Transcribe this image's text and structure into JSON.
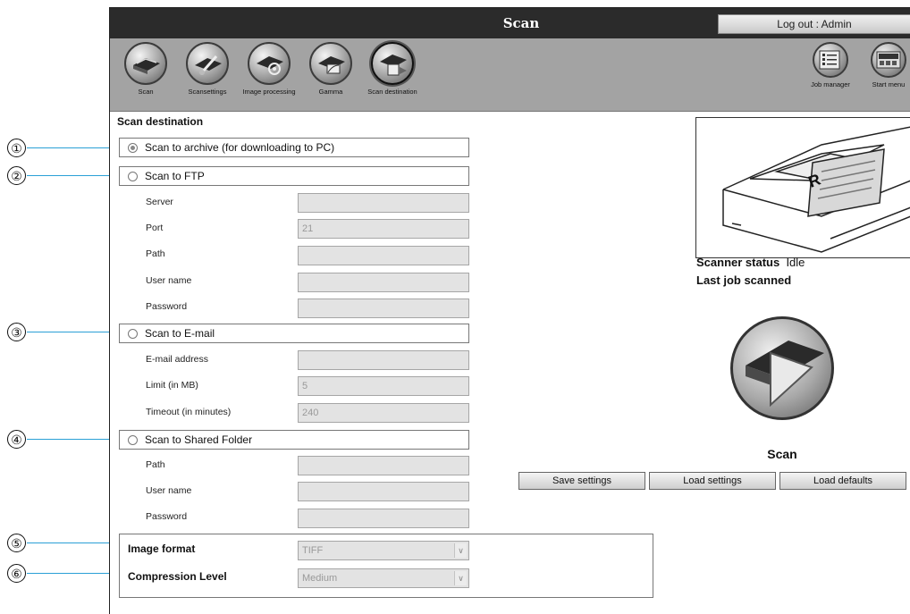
{
  "header": {
    "title": "Scan",
    "logout_label": "Log out : Admin"
  },
  "toolbar": {
    "items": [
      {
        "label": "Scan",
        "icon": "scanner-icon"
      },
      {
        "label": "Scansettings",
        "icon": "scan-settings-icon"
      },
      {
        "label": "Image processing",
        "icon": "image-processing-icon"
      },
      {
        "label": "Gamma",
        "icon": "gamma-icon"
      },
      {
        "label": "Scan destination",
        "icon": "scan-destination-icon"
      },
      {
        "label": "Job manager",
        "icon": "job-manager-icon"
      },
      {
        "label": "Start menu",
        "icon": "start-menu-icon"
      }
    ]
  },
  "page": {
    "section_title": "Scan destination"
  },
  "destinations": {
    "archive": {
      "label": "Scan to archive (for downloading to PC)",
      "checked": true
    },
    "ftp": {
      "label": "Scan to FTP",
      "fields": [
        {
          "label": "Server",
          "value": ""
        },
        {
          "label": "Port",
          "value": "21"
        },
        {
          "label": "Path",
          "value": ""
        },
        {
          "label": "User name",
          "value": ""
        },
        {
          "label": "Password",
          "value": ""
        }
      ]
    },
    "email": {
      "label": "Scan to E-mail",
      "fields": [
        {
          "label": "E-mail address",
          "value": ""
        },
        {
          "label": "Limit (in MB)",
          "value": "5"
        },
        {
          "label": "Timeout (in minutes)",
          "value": "240"
        }
      ]
    },
    "shared": {
      "label": "Scan to Shared Folder",
      "fields": [
        {
          "label": "Path",
          "value": ""
        },
        {
          "label": "User name",
          "value": ""
        },
        {
          "label": "Password",
          "value": ""
        }
      ]
    }
  },
  "format": {
    "image_format_label": "Image format",
    "image_format_value": "TIFF",
    "compression_label": "Compression Level",
    "compression_value": "Medium"
  },
  "status": {
    "scanner_status_label": "Scanner status",
    "scanner_status_value": "Idle",
    "last_job_label": "Last job scanned",
    "scan_label": "Scan"
  },
  "buttons": {
    "save": "Save settings",
    "load": "Load settings",
    "defaults": "Load defaults"
  },
  "callouts": [
    "①",
    "②",
    "③",
    "④",
    "⑤",
    "⑥"
  ],
  "colors": {
    "titlebar": "#2b2b2b",
    "toolbar": "#a3a3a3",
    "callout_line": "#2aa0d6"
  }
}
